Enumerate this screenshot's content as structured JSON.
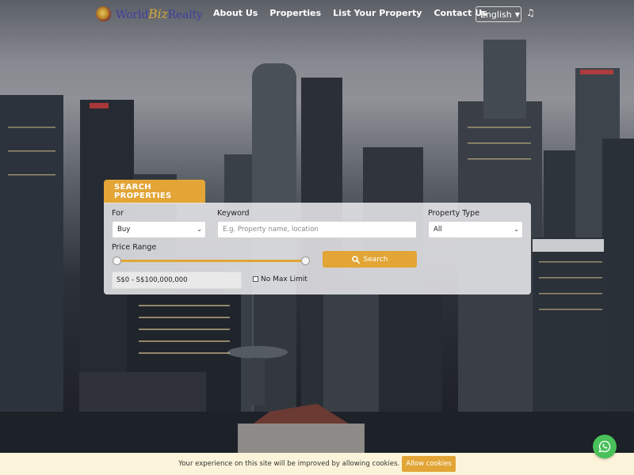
{
  "brand": {
    "name_part1": "World",
    "name_part2": "Biz",
    "name_part3": "Realty"
  },
  "nav": {
    "links": [
      "About Us",
      "Properties",
      "List Your Property",
      "Contact Us"
    ],
    "language": "English",
    "icons": [
      "music-note-icon",
      "chevron-down-icon"
    ]
  },
  "search": {
    "tab_label": "SEARCH PROPERTIES",
    "for_label": "For",
    "for_value": "Buy",
    "keyword_label": "Keyword",
    "keyword_placeholder": "E.g. Property name, location",
    "type_label": "Property Type",
    "type_value": "All",
    "price_label": "Price Range",
    "price_value": "S$0 - S$100,000,000",
    "price_min_fraction": 0.0,
    "price_max_fraction": 1.0,
    "no_max_label": "No Max Limit",
    "no_max_checked": false,
    "search_label": "Search"
  },
  "cookie": {
    "text": "Your experience on this site will be improved by allowing cookies.",
    "button_label": "Allow cookies"
  },
  "colors": {
    "accent": "#e2a536",
    "whatsapp": "#49c05a",
    "cookie_bg": "#fcf4da"
  }
}
